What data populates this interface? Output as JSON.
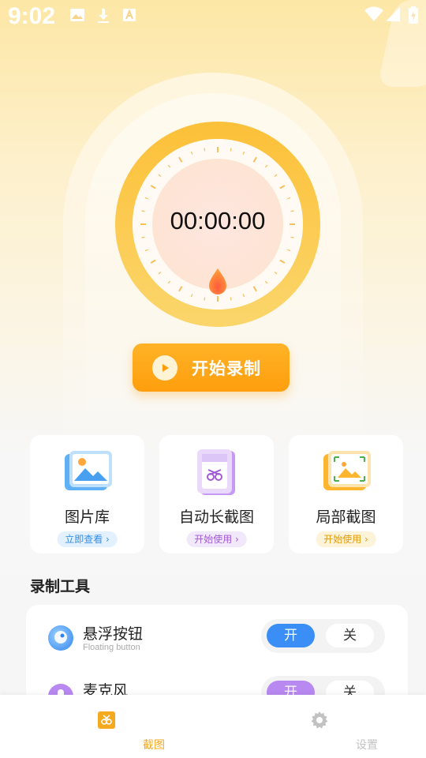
{
  "status_bar": {
    "time": "9:02"
  },
  "timer": {
    "value": "00:00:00"
  },
  "record_button": {
    "label": "开始录制"
  },
  "feature_cards": [
    {
      "title": "图片库",
      "action": "立即查看 ›",
      "pill_bg": "#e3f0fd",
      "pill_color": "#2f8ee8"
    },
    {
      "title": "自动长截图",
      "action": "开始使用 ›",
      "pill_bg": "#f1e8fb",
      "pill_color": "#a05ad6"
    },
    {
      "title": "局部截图",
      "action": "开始使用 ›",
      "pill_bg": "#fdf3d8",
      "pill_color": "#e39a0c"
    }
  ],
  "tools_section": {
    "title": "录制工具",
    "items": [
      {
        "name": "悬浮按钮",
        "subtitle": "Floating button",
        "on_label": "开",
        "off_label": "关",
        "on_color": "#3a8ef6"
      },
      {
        "name": "麦克风",
        "subtitle": "",
        "on_label": "开",
        "off_label": "关",
        "on_color": "#b889f0"
      }
    ]
  },
  "bottom_nav": [
    {
      "label": "截图",
      "active": true,
      "color": "#f5a91f"
    },
    {
      "label": "设置",
      "active": false,
      "color": "#c2c2c2"
    }
  ],
  "colors": {
    "accent": "#ffa61a",
    "ring": "#fcc43f"
  }
}
